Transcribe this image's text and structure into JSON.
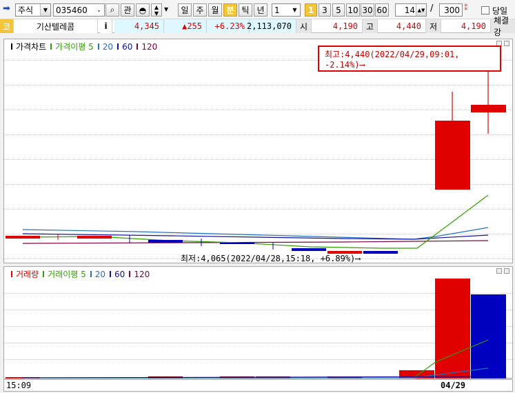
{
  "toolbar": {
    "market_type": "주식",
    "stock_code": "035460",
    "btn_gwan": "관",
    "period_buttons": [
      "일",
      "주",
      "월",
      "분",
      "틱",
      "년"
    ],
    "active_period": "분",
    "interval_value": "1",
    "interval_buttons": [
      "1",
      "3",
      "5",
      "10",
      "30",
      "60"
    ],
    "active_interval": "1",
    "view_count": "14",
    "total_count": "300",
    "same_day_label": "당일"
  },
  "info_bar": {
    "code_badge": "코",
    "stock_name": "기산텔레콤",
    "info_btn": "i",
    "price": "4,345",
    "change": "▲255",
    "change_rate": "+6.23%",
    "volume": "2,113,070",
    "open_label": "시",
    "open": "4,190",
    "high_label": "고",
    "high": "4,440",
    "low_label": "저",
    "low": "4,190",
    "trade_strength_label": "체결강"
  },
  "price_chart": {
    "legend_title": "가격차트",
    "ma_label": "가격이평 5",
    "ma_periods": [
      "20",
      "60",
      "120"
    ],
    "high_annotation": "최고:4,440(2022/04/29,09:01, -2.14%)⟶",
    "low_annotation": "최저:4,065(2022/04/28,15:18, +6.89%)⟶"
  },
  "volume_chart": {
    "legend_title": "거래량",
    "ma_label": "거래이평 5",
    "ma_periods": [
      "20",
      "60",
      "120"
    ]
  },
  "x_axis": {
    "left_label": "15:09",
    "date_label": "04/29"
  },
  "colors": {
    "up": "#e00000",
    "down": "#0000c0",
    "ma5": "#2fa000",
    "ma20": "#2070c0",
    "ma60": "#1010a0",
    "ma120": "#800040"
  }
}
